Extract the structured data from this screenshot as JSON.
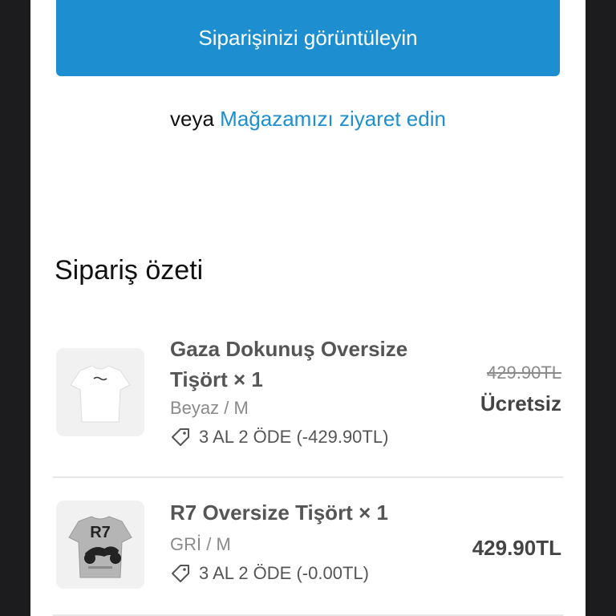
{
  "cta": {
    "view_order_label": "Siparişinizi görüntüleyin",
    "or_text": "veya",
    "visit_store_link": "Mağazamızı ziyaret edin"
  },
  "summary": {
    "title": "Sipariş özeti",
    "items": [
      {
        "name": "Gaza Dokunuş Oversize Tişört × 1",
        "variant": "Beyaz / M",
        "discount": "3 AL 2 ÖDE (-429.90TL)",
        "old_price": "429.90TL",
        "price": "Ücretsiz",
        "thumb_icon": "white-tshirt-image"
      },
      {
        "name": "R7 Oversize Tişört × 1",
        "variant": "GRİ / M",
        "discount": "3 AL 2 ÖDE (-0.00TL)",
        "price": "429.90TL",
        "thumb_icon": "grey-tshirt-motorcycle-image",
        "thumb_print": "R7"
      }
    ]
  },
  "colors": {
    "accent": "#1d8fd0",
    "frame": "#1c1c1e"
  }
}
